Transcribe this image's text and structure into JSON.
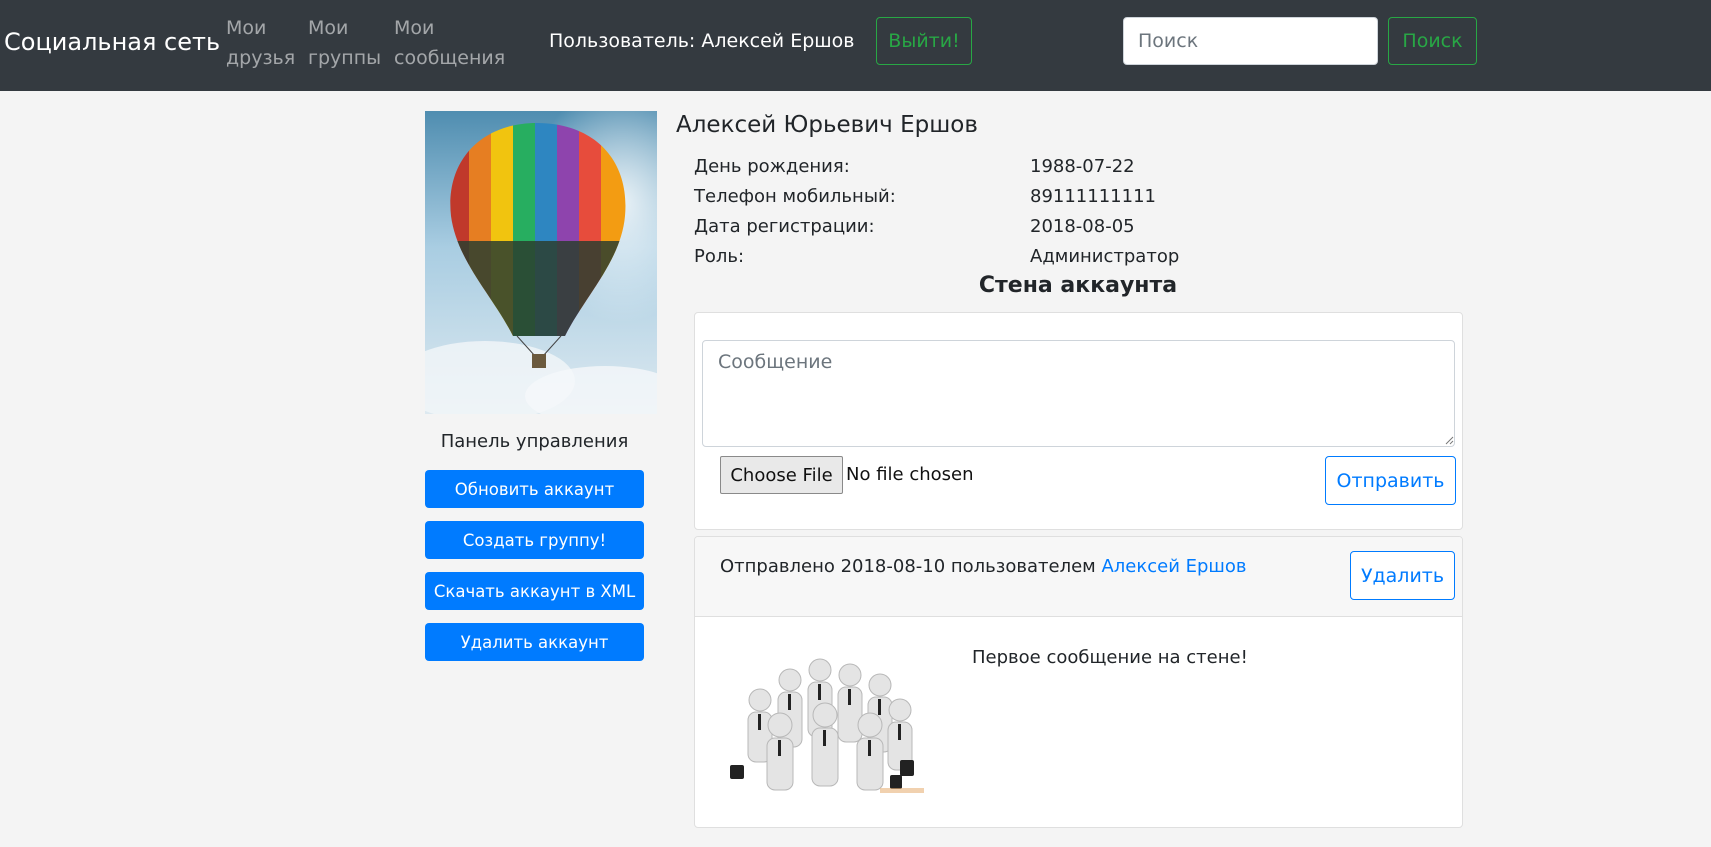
{
  "navbar": {
    "brand": "Социальная сеть",
    "links": [
      {
        "line1": "Мои",
        "line2": "друзья"
      },
      {
        "line1": "Мои",
        "line2": "группы"
      },
      {
        "line1": "Мои",
        "line2": "сообщения"
      }
    ],
    "user_label": "Пользователь: Алексей Ершов",
    "logout_label": "Выйти!",
    "search_placeholder": "Поиск",
    "search_button": "Поиск"
  },
  "sidebar": {
    "avatar_icon": "hot-air-balloon-photo",
    "panel_title": "Панель управления",
    "buttons": [
      "Обновить аккаунт",
      "Создать группу!",
      "Скачать аккаунт в XML",
      "Удалить аккаунт"
    ]
  },
  "profile": {
    "full_name": "Алексей Юрьевич Ершов",
    "fields": [
      {
        "label": "День рождения:",
        "value": "1988-07-22"
      },
      {
        "label": "Телефон мобильный:",
        "value": "89111111111"
      },
      {
        "label": "Дата регистрации:",
        "value": "2018-08-05"
      },
      {
        "label": "Роль:",
        "value": "Администратор"
      }
    ]
  },
  "wall": {
    "title": "Стена аккаунта",
    "message_placeholder": "Сообщение",
    "file_button": "Choose File",
    "file_status": "No file chosen",
    "send_button": "Отправить",
    "posts": [
      {
        "meta_prefix": "Отправлено 2018-08-10 пользователем",
        "author": "Алексей Ершов",
        "delete_button": "Удалить",
        "image_icon": "team-figures-image",
        "text": "Первое сообщение на стене!"
      }
    ]
  },
  "colors": {
    "navbar_bg": "#343a40",
    "primary": "#007bff",
    "success": "#28a745",
    "page_bg": "#f4f4f4"
  }
}
